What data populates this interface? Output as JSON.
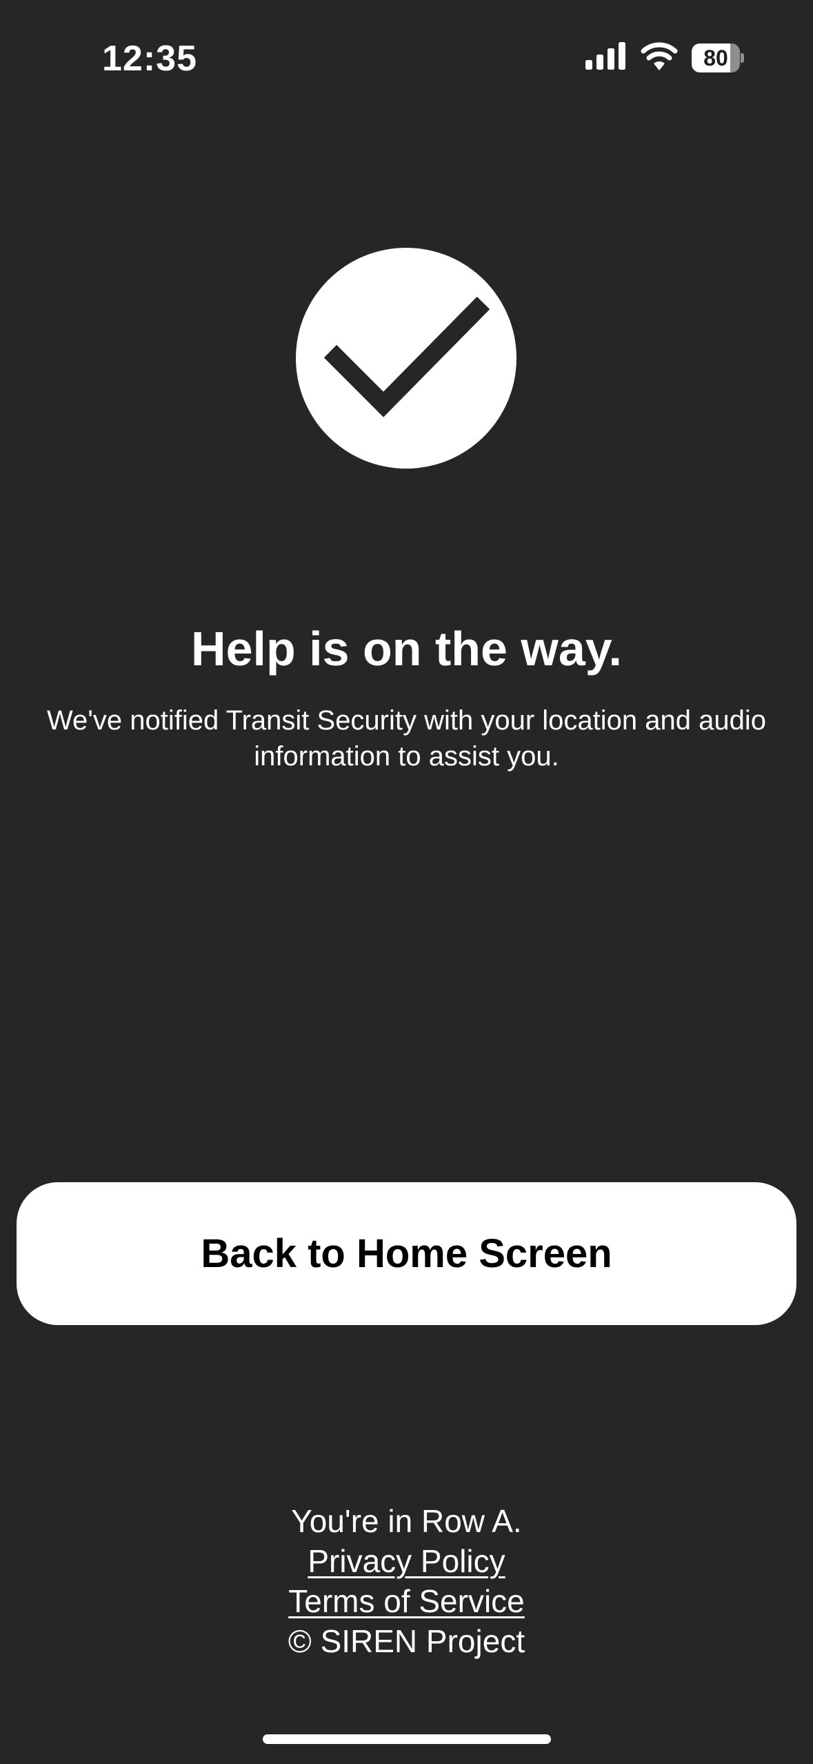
{
  "status_bar": {
    "time": "12:35",
    "battery_level": "80",
    "battery_fraction": 0.8,
    "icons": [
      "cellular-signal-icon",
      "wifi-icon",
      "battery-icon"
    ]
  },
  "confirmation": {
    "icon": "checkmark-icon",
    "headline": "Help is on the way.",
    "message": "We've notified Transit Security with your location and audio information to assist you."
  },
  "actions": {
    "home_button_label": "Back to Home Screen"
  },
  "footer": {
    "row_text": "You're in Row A.",
    "privacy_label": "Privacy Policy",
    "terms_label": "Terms of Service",
    "copyright": "© SIREN Project"
  },
  "colors": {
    "background": "#262627",
    "foreground": "#ffffff",
    "button_text": "#000000"
  }
}
